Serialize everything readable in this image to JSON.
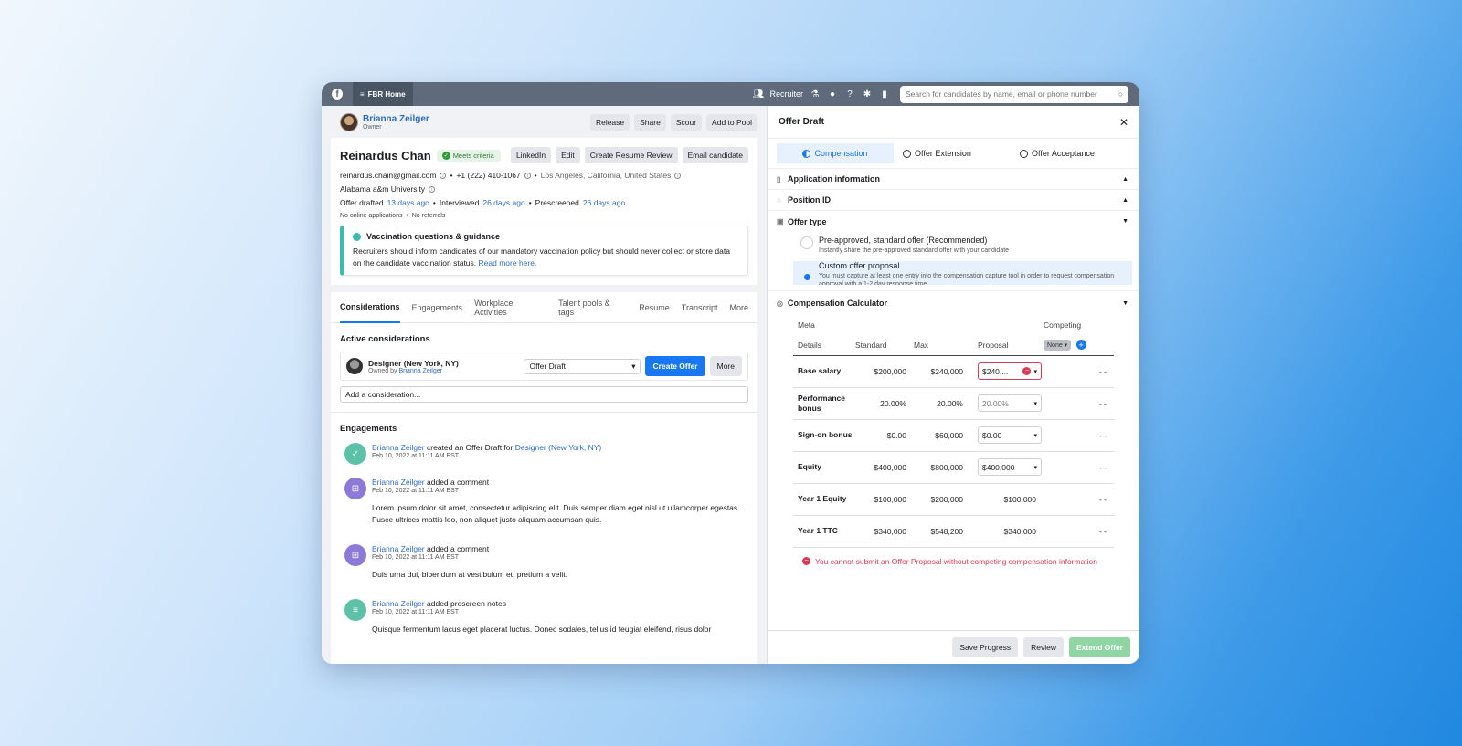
{
  "topbar": {
    "home_label": "FBR Home",
    "role_label": "Recruiter",
    "search_placeholder": "Search for candidates by name, email or phone number"
  },
  "owner": {
    "name": "Brianna Zeilger",
    "role": "Owner",
    "actions": [
      "Release",
      "Share",
      "Scour",
      "Add to Pool"
    ]
  },
  "candidate": {
    "name": "Reinardus Chan",
    "criteria_label": "Meets criteria",
    "actions": [
      "LinkedIn",
      "Edit",
      "Create Resume Review",
      "Email candidate"
    ],
    "email": "reinardus.chain@gmail.com",
    "phone": "+1 (222) 410-1067",
    "location": "Los Angeles, California, United States",
    "school": "Alabama a&m University",
    "offer_drafted_label": "Offer drafted",
    "offer_drafted_ago": "13 days ago",
    "interviewed_label": "Interviewed",
    "interviewed_ago": "26 days ago",
    "prescreened_label": "Prescreened",
    "prescreened_ago": "26 days ago",
    "apps_note": "No online applications",
    "referrals_note": "No referrals"
  },
  "notice": {
    "title": "Vaccination questions & guidance",
    "body": "Recruiters should inform candidates of our mandatory vaccination policy but should never collect or store data on the candidate vaccination status.",
    "link": "Read more here."
  },
  "tabs": [
    "Considerations",
    "Engagements",
    "Workplace Activities",
    "Talent pools & tags",
    "Resume",
    "Transcript",
    "More"
  ],
  "considerations": {
    "title": "Active considerations",
    "item_title": "Designer (New York, NY)",
    "owned_by_label": "Owned by",
    "owned_by": "Brianna Zeilger",
    "status": "Offer Draft",
    "create_offer": "Create Offer",
    "more": "More",
    "add_placeholder": "Add a consideration..."
  },
  "engagements": {
    "title": "Engagements",
    "items": [
      {
        "who": "Brianna Zeilger",
        "action": "created an Offer Draft for",
        "target": "Designer (New York, NY)",
        "ts": "Feb 10, 2022 at 11:11 AM EST",
        "body": "",
        "color": "#5dc1a9",
        "icon": "calendar-check-icon"
      },
      {
        "who": "Brianna Zeilger",
        "action": "added a comment",
        "target": "",
        "ts": "Feb 10, 2022 at 11:11 AM EST",
        "body": "Lorem ipsum dolor sit amet, consectetur adipiscing elit. Duis semper diam eget nisl ut ullamcorper egestas. Fusce ultrices mattis leo, non aliquet justo aliquam accumsan quis.",
        "color": "#8c7ad6",
        "icon": "comment-icon"
      },
      {
        "who": "Brianna Zeilger",
        "action": "added a comment",
        "target": "",
        "ts": "Feb 10, 2022 at 11:11 AM EST",
        "body": "Duis urna dui, bibendum at vestibulum et, pretium a velit.",
        "color": "#8c7ad6",
        "icon": "comment-icon"
      },
      {
        "who": "Brianna Zeilger",
        "action": "added prescreen notes",
        "target": "",
        "ts": "Feb 10, 2022 at 11:11 AM EST",
        "body": "Quisque fermentum lacus eget placerat luctus. Donec sodales, tellus id feugiat eleifend, risus dolor",
        "color": "#5dc1a9",
        "icon": "notes-icon"
      }
    ]
  },
  "offer": {
    "title": "Offer Draft",
    "steps": [
      "Compensation",
      "Offer Extension",
      "Offer Acceptance"
    ],
    "sections": [
      "Application information",
      "Position ID",
      "Offer type",
      "Compensation Calculator"
    ],
    "offer_types": [
      {
        "title": "Pre-approved, standard offer (Recommended)",
        "desc": "Instantly share the pre-approved standard offer with your candidate"
      },
      {
        "title": "Custom offer proposal",
        "desc": "You must capture at least one entry into the compensation capture tool in order to request compensation approval with a 1-2 day response time"
      }
    ],
    "table": {
      "meta_label": "Meta",
      "competing_label": "Competing",
      "headers": [
        "Details",
        "Standard",
        "Max",
        "Proposal"
      ],
      "none_label": "None",
      "rows": [
        {
          "label": "Base salary",
          "standard": "$200,000",
          "max": "$240,000",
          "proposal": "$240,...",
          "competing": "- -"
        },
        {
          "label": "Performance bonus",
          "standard": "20.00%",
          "max": "20.00%",
          "proposal": "20.00%",
          "competing": "- -"
        },
        {
          "label": "Sign-on bonus",
          "standard": "$0.00",
          "max": "$60,000",
          "proposal": "$0.00",
          "competing": "- -"
        },
        {
          "label": "Equity",
          "standard": "$400,000",
          "max": "$800,000",
          "proposal": "$400,000",
          "competing": "- -"
        },
        {
          "label": "Year 1 Equity",
          "standard": "$100,000",
          "max": "$200,000",
          "proposal": "$100,000",
          "competing": "- -"
        },
        {
          "label": "Year 1 TTC",
          "standard": "$340,000",
          "max": "$548,200",
          "proposal": "$340,000",
          "competing": "- -"
        }
      ]
    },
    "error": "You cannot submit an Offer Proposal without competing compensation information",
    "footer": [
      "Save Progress",
      "Review",
      "Extend Offer"
    ]
  }
}
